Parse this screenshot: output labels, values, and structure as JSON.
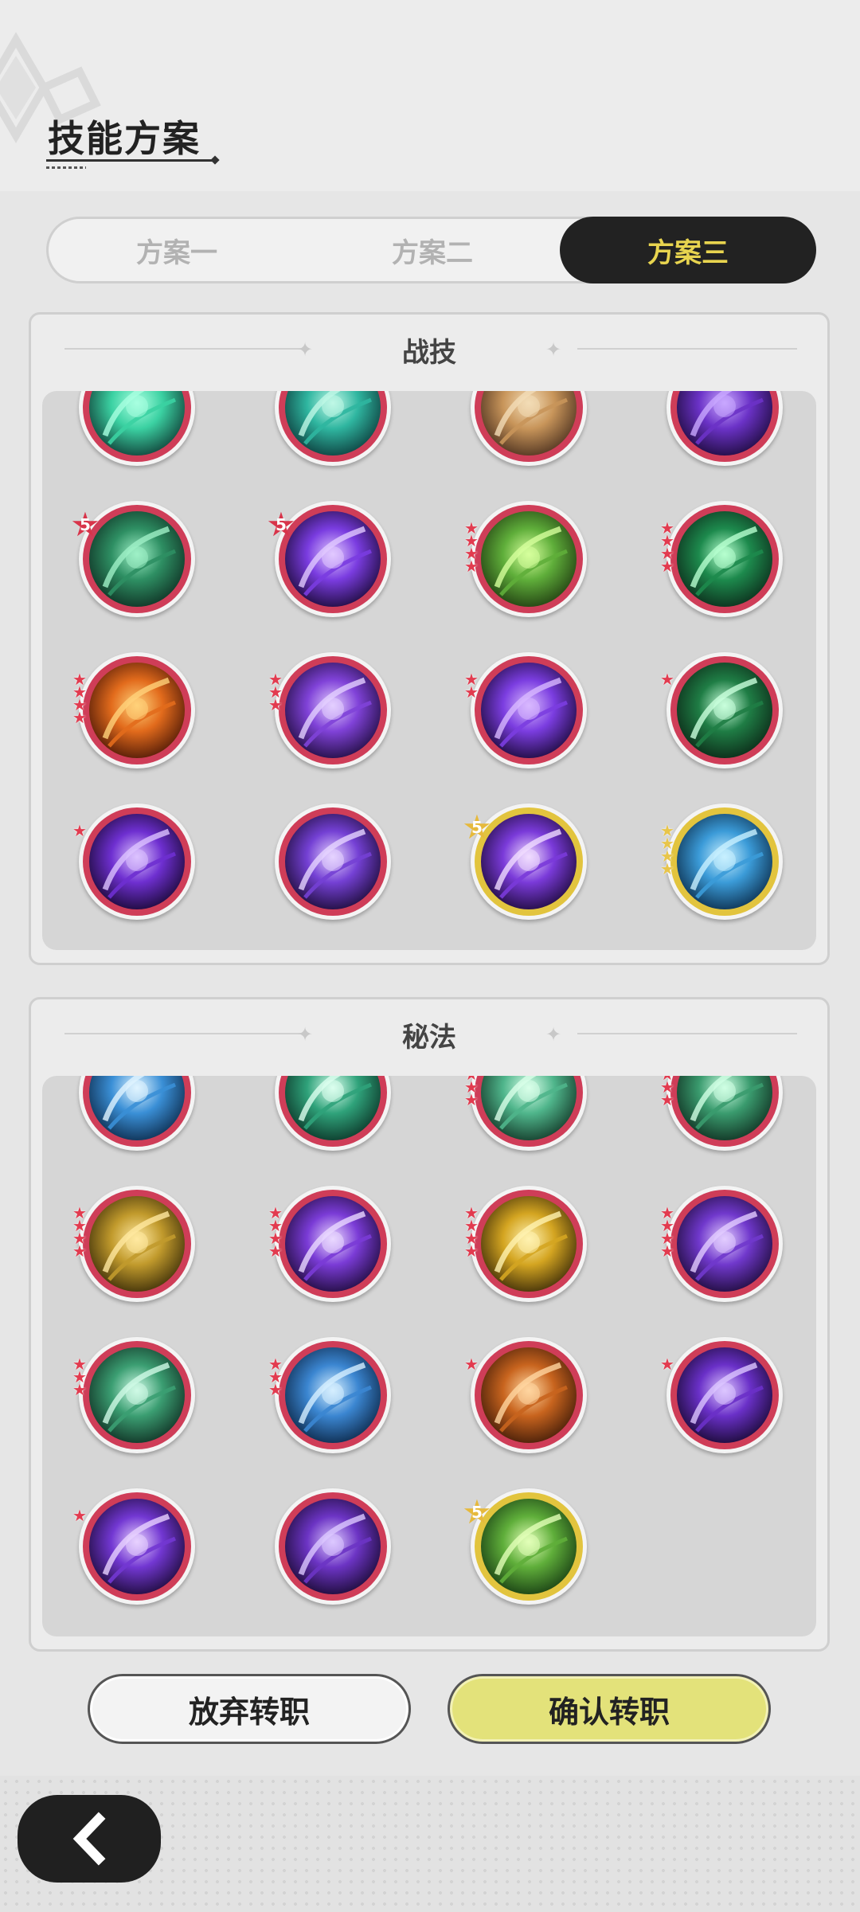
{
  "header": {
    "title": "技能方案"
  },
  "tabs": [
    {
      "label": "方案一",
      "selected": false
    },
    {
      "label": "方案二",
      "selected": false
    },
    {
      "label": "方案三",
      "selected": true
    }
  ],
  "combat_section": {
    "title": "战技",
    "skills": [
      {
        "theme": "teal-slash-icon",
        "rarity": "red"
      },
      {
        "theme": "teal-vortex-icon",
        "rarity": "red"
      },
      {
        "theme": "brown-claw-icon",
        "rarity": "red"
      },
      {
        "theme": "purple-orb-icon",
        "rarity": "red"
      },
      {
        "theme": "thorn-ring-icon",
        "rarity": "red",
        "badge": "5"
      },
      {
        "theme": "purple-eye-icon",
        "rarity": "red",
        "badge": "5"
      },
      {
        "theme": "tree-stump-icon",
        "rarity": "red",
        "stars": 4
      },
      {
        "theme": "green-cross-icon",
        "rarity": "red",
        "stars": 4
      },
      {
        "theme": "fire-wolf-icon",
        "rarity": "red",
        "stars": 4
      },
      {
        "theme": "purple-crown-icon",
        "rarity": "red",
        "stars": 3
      },
      {
        "theme": "purple-swirl-icon",
        "rarity": "red",
        "stars": 2
      },
      {
        "theme": "green-bubbles-icon",
        "rarity": "red",
        "stars": 1
      },
      {
        "theme": "purple-strike-icon",
        "rarity": "red",
        "stars": 1
      },
      {
        "theme": "purple-arrow-icon",
        "rarity": "red"
      },
      {
        "theme": "purple-emblem-icon",
        "rarity": "gold",
        "badge": "5"
      },
      {
        "theme": "ice-crystal-icon",
        "rarity": "gold",
        "stars": 4
      }
    ]
  },
  "secret_section": {
    "title": "秘法",
    "skills": [
      {
        "theme": "blue-figure-icon",
        "rarity": "red"
      },
      {
        "theme": "green-figure-icon",
        "rarity": "red"
      },
      {
        "theme": "green-cloak-icon",
        "rarity": "red",
        "stars": 4
      },
      {
        "theme": "green-helm-icon",
        "rarity": "red",
        "stars": 4
      },
      {
        "theme": "gold-shield-icon",
        "rarity": "red",
        "stars": 4
      },
      {
        "theme": "purple-rune-icon",
        "rarity": "red",
        "stars": 4
      },
      {
        "theme": "gold-burst-icon",
        "rarity": "red",
        "stars": 4
      },
      {
        "theme": "purple-hand-icon",
        "rarity": "red",
        "stars": 4
      },
      {
        "theme": "green-golem-icon",
        "rarity": "red",
        "stars": 3
      },
      {
        "theme": "blue-shard-icon",
        "rarity": "red",
        "stars": 3
      },
      {
        "theme": "orange-roar-icon",
        "rarity": "red",
        "stars": 1
      },
      {
        "theme": "purple-cross-icon",
        "rarity": "red",
        "stars": 1
      },
      {
        "theme": "purple-sigil-icon",
        "rarity": "red",
        "stars": 1
      },
      {
        "theme": "purple-eye2-icon",
        "rarity": "red"
      },
      {
        "theme": "green-potion-icon",
        "rarity": "gold",
        "badge": "5"
      }
    ]
  },
  "buttons": {
    "cancel_label": "放弃转职",
    "confirm_label": "确认转职"
  },
  "colors": {
    "red_ring": "#cf3d58",
    "gold_ring": "#e2c43e",
    "tab_active_bg": "#222222",
    "tab_active_text": "#e8d44f",
    "confirm_bg": "#e3e27a"
  }
}
